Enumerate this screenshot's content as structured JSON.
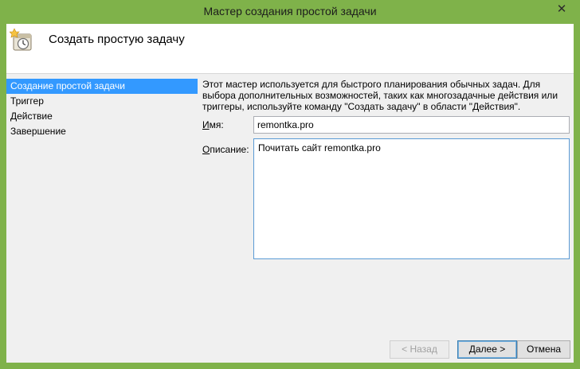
{
  "window": {
    "title": "Мастер создания простой задачи",
    "close_glyph": "✕",
    "accent_color": "#7fb24a"
  },
  "header": {
    "icon": "task-scheduler-clock-icon",
    "title": "Создать простую задачу"
  },
  "nav": {
    "items": [
      {
        "label": "Создание простой задачи",
        "selected": true
      },
      {
        "label": "Триггер",
        "selected": false
      },
      {
        "label": "Действие",
        "selected": false
      },
      {
        "label": "Завершение",
        "selected": false
      }
    ]
  },
  "main": {
    "intro": "Этот мастер используется для быстрого планирования обычных задач.  Для выбора дополнительных возможностей, таких как многозадачные действия или триггеры, используйте команду \"Создать задачу\" в области \"Действия\".",
    "name_label_underlined": "И",
    "name_label_rest": "мя:",
    "name_value": "remontka.pro",
    "description_label_underlined": "О",
    "description_label_rest": "писание:",
    "description_value": "Почитать сайт remontka.pro"
  },
  "buttons": {
    "back": "< Назад",
    "next": "Далее >",
    "cancel": "Отмена"
  }
}
